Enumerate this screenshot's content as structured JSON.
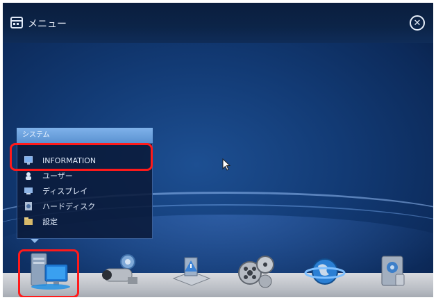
{
  "window": {
    "title": "メニュー"
  },
  "popup": {
    "header": "システム",
    "items": [
      {
        "label": "INFORMATION",
        "icon": "information-icon"
      },
      {
        "label": "ユーザー",
        "icon": "user-icon"
      },
      {
        "label": "ディスプレイ",
        "icon": "display-icon"
      },
      {
        "label": "ハードディスク",
        "icon": "hard-disk-icon"
      },
      {
        "label": "設定",
        "icon": "settings-icon"
      }
    ]
  },
  "dock": {
    "items": [
      {
        "name": "system",
        "icon": "computer-icon"
      },
      {
        "name": "camera",
        "icon": "camera-gear-icon"
      },
      {
        "name": "alarm",
        "icon": "warning-device-icon"
      },
      {
        "name": "recording",
        "icon": "film-reel-icon"
      },
      {
        "name": "network",
        "icon": "globe-icon"
      },
      {
        "name": "storage",
        "icon": "speaker-device-icon"
      }
    ]
  },
  "colors": {
    "highlight": "#ff1a1a",
    "titlebar": "#0c2448",
    "background": "#123a74"
  }
}
